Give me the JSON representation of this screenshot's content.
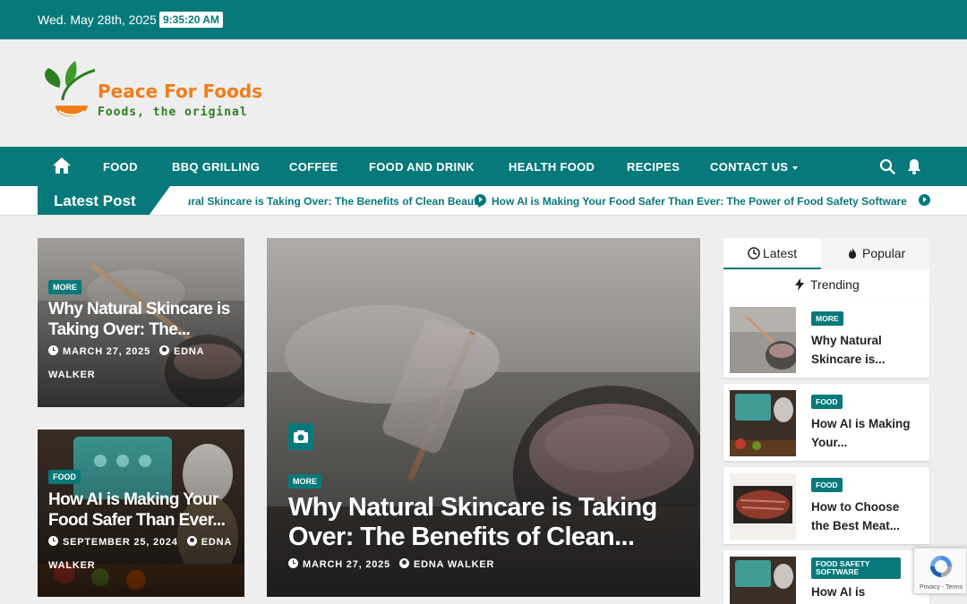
{
  "topbar": {
    "date": "Wed. May 28th, 2025",
    "time": "9:35:20 AM"
  },
  "brand": {
    "title": "Peace For Foods",
    "tagline": "Foods, the original"
  },
  "nav": {
    "items": [
      "FOOD",
      "BBQ GRILLING",
      "COFFEE",
      "FOOD AND DRINK",
      "HEALTH FOOD",
      "RECIPES",
      "CONTACT US"
    ]
  },
  "ticker": {
    "label": "Latest Post",
    "items": [
      "Why Natural Skincare is Taking Over: The Benefits of Clean Beauty",
      "How AI is Making Your Food Safer Than Ever: The Power of Food Safety Software"
    ]
  },
  "cards": {
    "left1": {
      "badge": "MORE",
      "title": "Why Natural Skincare is Taking Over: The...",
      "date": "MARCH 27, 2025",
      "author": "EDNA WALKER"
    },
    "left2": {
      "badge": "FOOD",
      "title": "How AI is Making Your Food Safer Than Ever...",
      "date": "SEPTEMBER 25, 2024",
      "author": "EDNA WALKER"
    },
    "main": {
      "badge": "MORE",
      "title": "Why Natural Skincare is Taking Over: The Benefits of Clean...",
      "date": "MARCH 27, 2025",
      "author": "EDNA WALKER"
    }
  },
  "sidebar": {
    "tabs": [
      "Latest",
      "Popular",
      "Trending"
    ],
    "items": [
      {
        "badge": "MORE",
        "title": "Why Natural Skincare is..."
      },
      {
        "badge": "FOOD",
        "title": "How AI is Making Your..."
      },
      {
        "badge": "FOOD",
        "title": "How to Choose the Best Meat..."
      },
      {
        "badge": "FOOD SAFETY SOFTWARE",
        "title": "How AI is"
      }
    ]
  },
  "recaptcha": {
    "text": "Privacy - Terms"
  },
  "colors": {
    "primary": "#08797a",
    "orange": "#f07d1a",
    "green": "#2e7d22"
  }
}
